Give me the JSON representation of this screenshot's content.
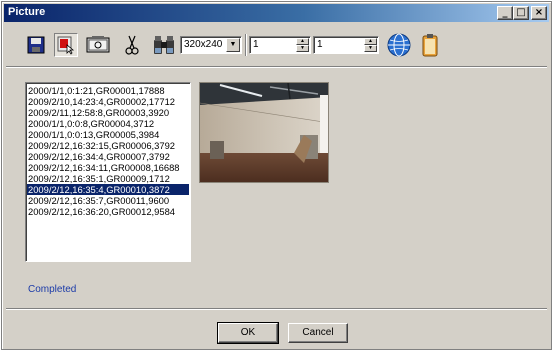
{
  "window": {
    "title": "Picture",
    "controls": {
      "minimize": "_",
      "maximize": "□",
      "close": "×"
    }
  },
  "toolbar": {
    "tools": [
      "save-icon",
      "record-icon",
      "camera-snapshot-icon",
      "cut-icon",
      "binoculars-icon",
      "network-globe-icon",
      "clipboard-icon"
    ],
    "resolution": {
      "selected": "320x240"
    },
    "spin_start": "1",
    "spin_end": "1"
  },
  "file_list": {
    "items": [
      "2000/1/1,0:1:21,GR00001,17888",
      "2009/2/10,14:23:4,GR00002,17712",
      "2009/2/11,12:58:8,GR00003,3920",
      "2000/1/1,0:0:8,GR00004,3712",
      "2000/1/1,0:0:13,GR00005,3984",
      "2009/2/12,16:32:15,GR00006,3792",
      "2009/2/12,16:34:4,GR00007,3792",
      "2009/2/12,16:34:11,GR00008,16688",
      "2009/2/12,16:35:1,GR00009,1712",
      "2009/2/12,16:35:4,GR00010,3872",
      "2009/2/12,16:35:7,GR00011,9600",
      "2009/2/12,16:36:20,GR00012,9584"
    ],
    "selected_index": 9
  },
  "status": {
    "text": "Completed",
    "color": "#1c3ba8"
  },
  "buttons": {
    "ok": "OK",
    "cancel": "Cancel"
  },
  "colors": {
    "titlebar": "#0a246a",
    "selection": "#0a246a",
    "face": "#d4d0c8"
  }
}
